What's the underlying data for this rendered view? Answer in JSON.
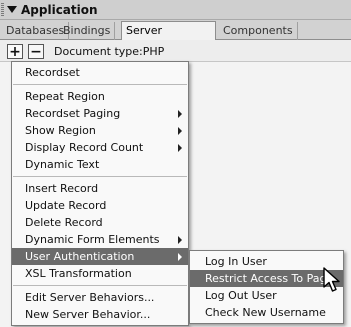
{
  "panel": {
    "title": "Application"
  },
  "tabs": [
    {
      "label": "Databases",
      "active": false
    },
    {
      "label": "Bindings",
      "active": false
    },
    {
      "label": "Server Behaviors",
      "active": true
    },
    {
      "label": "Components",
      "active": false
    }
  ],
  "toolbar": {
    "add_label": "+",
    "remove_label": "−",
    "doctype_label": "Document type:PHP"
  },
  "menu": {
    "items": [
      {
        "label": "Recordset",
        "submenu": false
      },
      {
        "label": "Repeat Region",
        "submenu": false
      },
      {
        "label": "Recordset Paging",
        "submenu": true
      },
      {
        "label": "Show Region",
        "submenu": true
      },
      {
        "label": "Display Record Count",
        "submenu": true
      },
      {
        "label": "Dynamic Text",
        "submenu": false
      },
      {
        "label": "Insert Record",
        "submenu": false
      },
      {
        "label": "Update Record",
        "submenu": false
      },
      {
        "label": "Delete Record",
        "submenu": false
      },
      {
        "label": "Dynamic Form Elements",
        "submenu": true
      },
      {
        "label": "User Authentication",
        "submenu": true,
        "highlighted": true
      },
      {
        "label": "XSL Transformation",
        "submenu": false
      },
      {
        "label": "Edit Server Behaviors...",
        "submenu": false
      },
      {
        "label": "New Server Behavior...",
        "submenu": false
      }
    ]
  },
  "submenu": {
    "items": [
      {
        "label": "Log In User"
      },
      {
        "label": "Restrict Access To Page",
        "highlighted": true
      },
      {
        "label": "Log Out User"
      },
      {
        "label": "Check New Username"
      }
    ]
  },
  "colors": {
    "highlight": "#6b6b6b",
    "menu_bg": "#f9f9f9",
    "panel_bg": "#e4e4e4"
  },
  "icons": {
    "header": "triangle-down-icon",
    "submenu_arrow": "chevron-right-icon",
    "cursor": "mouse-pointer-icon"
  }
}
